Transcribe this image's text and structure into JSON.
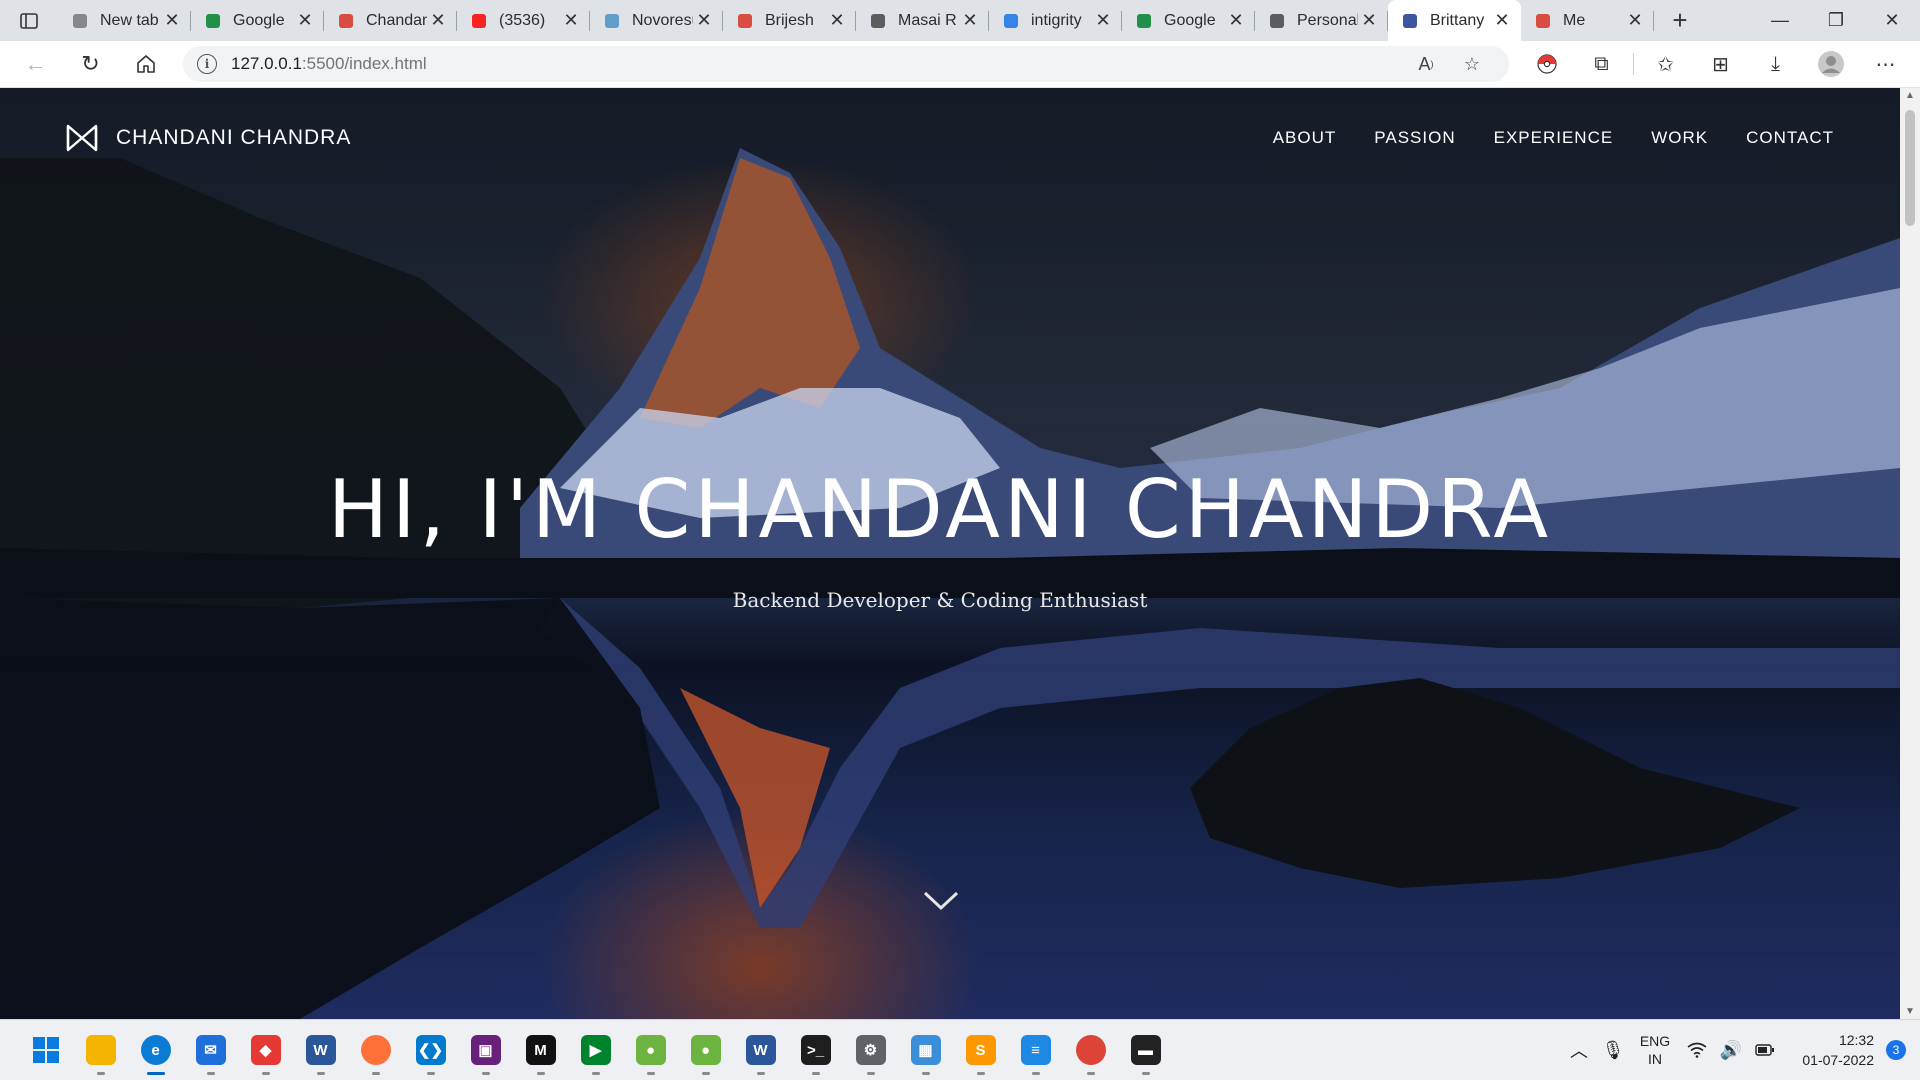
{
  "browser": {
    "tabs": [
      {
        "title": "New tab",
        "icon": "page-icon",
        "color": "#777777"
      },
      {
        "title": "Google",
        "icon": "google-meet-icon",
        "color": "#00832d"
      },
      {
        "title": "Chandani",
        "icon": "pdf-icon",
        "color": "#d93025"
      },
      {
        "title": "(3536)",
        "icon": "youtube-icon",
        "color": "#ff0000"
      },
      {
        "title": "Novoresume",
        "icon": "novoresume-icon",
        "color": "#4a90c2"
      },
      {
        "title": "Brijesh",
        "icon": "pdf-icon",
        "color": "#d93025"
      },
      {
        "title": "Masai R",
        "icon": "document-icon",
        "color": "#444444"
      },
      {
        "title": "intigrity",
        "icon": "search-icon",
        "color": "#1a73e8"
      },
      {
        "title": "Google",
        "icon": "google-meet-icon",
        "color": "#00832d"
      },
      {
        "title": "Personal",
        "icon": "document-icon",
        "color": "#444444"
      },
      {
        "title": "Brittany",
        "icon": "bowtie-logo-icon",
        "color": "#1a3a8f",
        "active": true
      },
      {
        "title": "Me",
        "icon": "recording-icon",
        "color": "#d93025"
      }
    ],
    "url_host": "127.0.0.1",
    "url_rest": ":5500/index.html"
  },
  "site": {
    "brand": "CHANDANI CHANDRA",
    "menu": [
      "ABOUT",
      "PASSION",
      "EXPERIENCE",
      "WORK",
      "CONTACT"
    ],
    "hero_title": "HI, I'M CHANDANI CHANDRA",
    "hero_subtitle": "Backend Developer & Coding Enthusiast"
  },
  "taskbar": {
    "apps": [
      {
        "name": "file-explorer",
        "color": "#f4b400",
        "glyph": ""
      },
      {
        "name": "edge",
        "color": "#0c7bd3",
        "glyph": "e",
        "active": true
      },
      {
        "name": "mail",
        "color": "#1e6fd9",
        "glyph": "✉"
      },
      {
        "name": "anydesk",
        "color": "#e53935",
        "glyph": "◆"
      },
      {
        "name": "word-online",
        "color": "#2b579a",
        "glyph": "W"
      },
      {
        "name": "firefox",
        "color": "#ff7139",
        "glyph": ""
      },
      {
        "name": "vscode",
        "color": "#007acc",
        "glyph": "❮❯"
      },
      {
        "name": "visual-studio",
        "color": "#68217a",
        "glyph": "▣"
      },
      {
        "name": "medium",
        "color": "#111111",
        "glyph": "M"
      },
      {
        "name": "google-meet",
        "color": "#00832d",
        "glyph": "▶"
      },
      {
        "name": "spring-tool",
        "color": "#6db33f",
        "glyph": "●"
      },
      {
        "name": "spring-boot",
        "color": "#6db33f",
        "glyph": "●"
      },
      {
        "name": "ms-word",
        "color": "#2b579a",
        "glyph": "W"
      },
      {
        "name": "terminal",
        "color": "#1e1e1e",
        "glyph": ">_"
      },
      {
        "name": "settings",
        "color": "#5f6368",
        "glyph": "⚙"
      },
      {
        "name": "control-panel",
        "color": "#3a8fd8",
        "glyph": "▦"
      },
      {
        "name": "sublime-text",
        "color": "#ff9800",
        "glyph": "S"
      },
      {
        "name": "notepad",
        "color": "#1e88e5",
        "glyph": "≡"
      },
      {
        "name": "chrome",
        "color": "#db4437",
        "glyph": ""
      },
      {
        "name": "mysql-shell",
        "color": "#222222",
        "glyph": "▬"
      }
    ],
    "lang_line1": "ENG",
    "lang_line2": "IN",
    "time": "12:32",
    "date": "01-07-2022",
    "notifications": "3"
  }
}
